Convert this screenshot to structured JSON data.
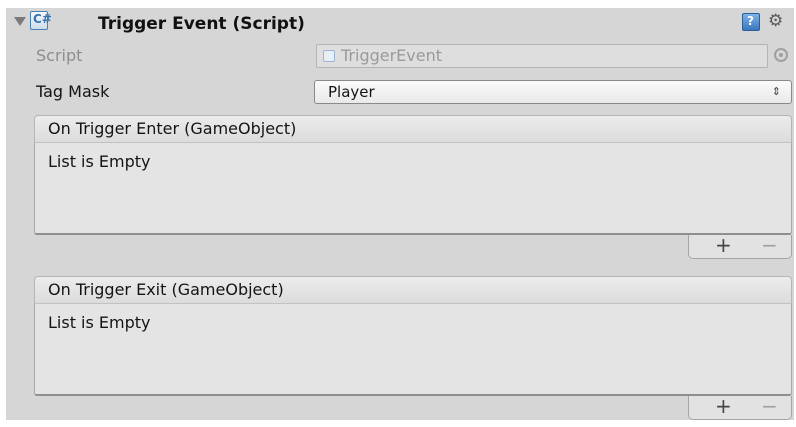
{
  "component": {
    "title": "Trigger Event (Script)"
  },
  "script_field": {
    "label": "Script",
    "value": "TriggerEvent"
  },
  "tag_mask": {
    "label": "Tag Mask",
    "value": "Player",
    "arrow": "⇕"
  },
  "events": [
    {
      "header": "On Trigger Enter (GameObject)",
      "empty_text": "List is Empty",
      "add_label": "+",
      "remove_label": "−"
    },
    {
      "header": "On Trigger Exit (GameObject)",
      "empty_text": "List is Empty",
      "add_label": "+",
      "remove_label": "−"
    }
  ],
  "icons": {
    "foldout": "foldout-arrow-icon",
    "script": "csharp-script-icon",
    "help": "help-icon",
    "settings": "gear-icon",
    "object_picker": "object-picker-icon"
  }
}
